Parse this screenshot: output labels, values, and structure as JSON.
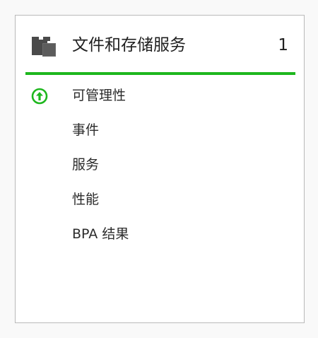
{
  "tile": {
    "title": "文件和存储服务",
    "count": "1",
    "icon": "folder-icon",
    "status_color": "#1eb71e"
  },
  "items": [
    {
      "label": "可管理性",
      "icon": "up-arrow-circle-icon",
      "icon_color": "#1eb71e"
    },
    {
      "label": "事件"
    },
    {
      "label": "服务"
    },
    {
      "label": "性能"
    },
    {
      "label": "BPA 结果"
    }
  ]
}
